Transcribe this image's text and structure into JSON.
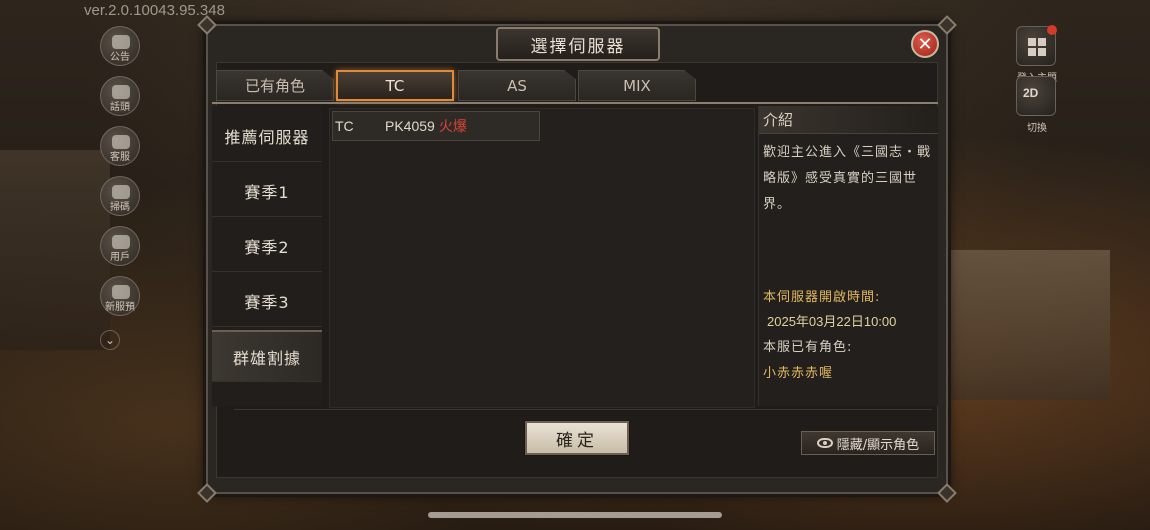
{
  "version": "ver.2.0.10043.95.348",
  "left_menu": [
    {
      "label": "公告",
      "icon": "announcement-icon"
    },
    {
      "label": "話頭",
      "icon": "topic-icon"
    },
    {
      "label": "客服",
      "icon": "customer-service-icon"
    },
    {
      "label": "掃碼",
      "icon": "scan-code-icon"
    },
    {
      "label": "用戶",
      "icon": "user-icon"
    },
    {
      "label": "新服預",
      "icon": "new-server-icon"
    }
  ],
  "right_menu": [
    {
      "label": "登入主題",
      "icon": "login-theme-icon"
    },
    {
      "label": "切換",
      "icon": "2d-3d-toggle-icon",
      "glyph": "2D"
    }
  ],
  "dialog": {
    "title": "選擇伺服器",
    "close_glyph": "✕",
    "tabs": [
      {
        "label": "已有角色",
        "active": false
      },
      {
        "label": "TC",
        "active": true
      },
      {
        "label": "AS",
        "active": false
      },
      {
        "label": "MIX",
        "active": false
      }
    ],
    "categories": [
      {
        "label": "推薦伺服器",
        "active": false
      },
      {
        "label": "賽季1",
        "active": false
      },
      {
        "label": "賽季2",
        "active": false
      },
      {
        "label": "賽季3",
        "active": false
      },
      {
        "label": "群雄割據",
        "active": true
      }
    ],
    "servers": [
      {
        "region": "TC",
        "name": "PK4059",
        "status": "火爆",
        "status_color": "#d8453a"
      }
    ],
    "intro": {
      "heading": "介紹",
      "welcome": "歡迎主公進入《三國志・戰略版》感受真實的三國世界。",
      "open_time_label": "本伺服器開啟時間:",
      "open_time": "2025年03月22日10:00",
      "role_label": "本服已有角色:",
      "role_name": "小赤赤赤喔"
    },
    "confirm_label": "確定",
    "toggle_label": "隱藏/顯示角色"
  },
  "colors": {
    "accent_tab": "#e08a3a",
    "hot": "#d8453a",
    "gold_text": "#e0b860"
  }
}
